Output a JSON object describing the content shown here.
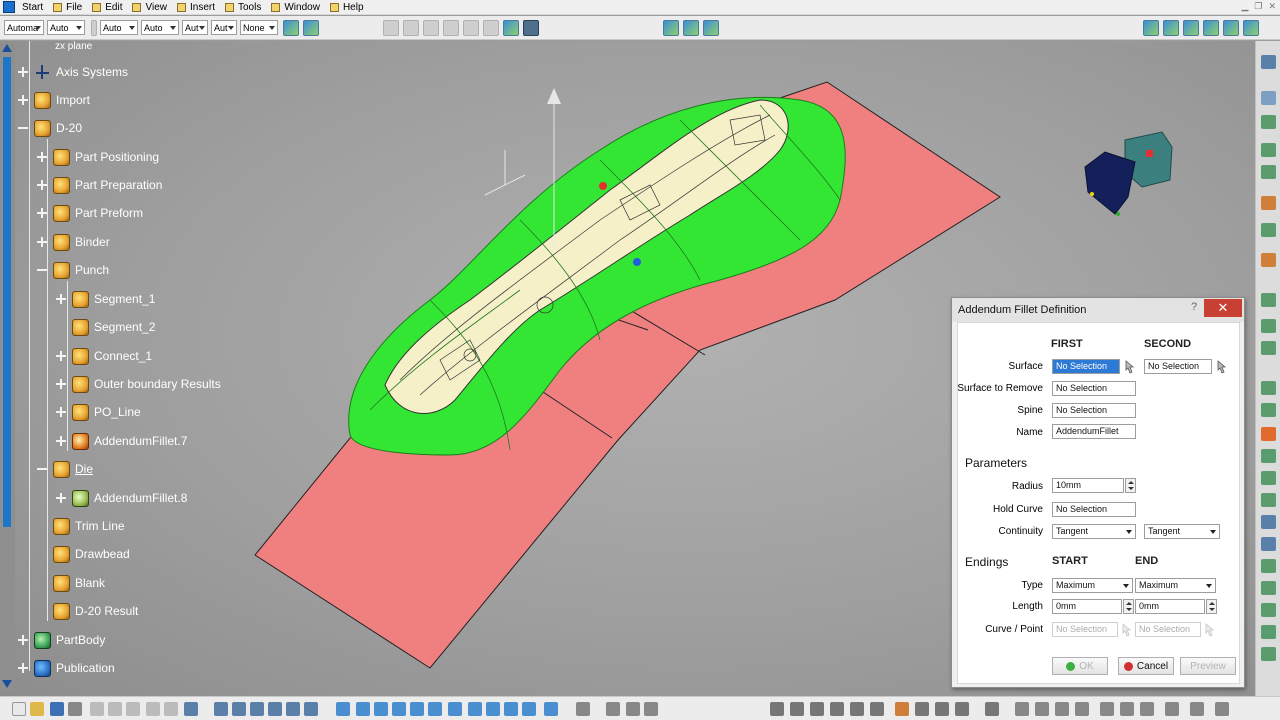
{
  "menu": {
    "items": [
      {
        "label": "Start"
      },
      {
        "label": "File"
      },
      {
        "label": "Edit"
      },
      {
        "label": "View"
      },
      {
        "label": "Insert"
      },
      {
        "label": "Tools"
      },
      {
        "label": "Window"
      },
      {
        "label": "Help"
      }
    ]
  },
  "toolbar": {
    "combos": [
      {
        "value": "Automa"
      },
      {
        "value": "Auto"
      },
      {
        "value": "Auto"
      },
      {
        "value": "Auto"
      },
      {
        "value": "Aut"
      },
      {
        "value": "Aut"
      },
      {
        "value": "None"
      }
    ]
  },
  "tree": {
    "items": [
      {
        "label": "zx plane"
      },
      {
        "label": "Axis Systems"
      },
      {
        "label": "Import"
      },
      {
        "label": "D-20"
      },
      {
        "label": "Part Positioning"
      },
      {
        "label": "Part Preparation"
      },
      {
        "label": "Part Preform"
      },
      {
        "label": "Binder"
      },
      {
        "label": "Punch"
      },
      {
        "label": "Segment_1"
      },
      {
        "label": "Segment_2"
      },
      {
        "label": "Connect_1"
      },
      {
        "label": "Outer boundary Results"
      },
      {
        "label": "PO_Line"
      },
      {
        "label": "AddendumFillet.7"
      },
      {
        "label": "Die"
      },
      {
        "label": "AddendumFillet.8"
      },
      {
        "label": "Trim Line"
      },
      {
        "label": "Drawbead"
      },
      {
        "label": "Blank"
      },
      {
        "label": "D-20 Result"
      },
      {
        "label": "PartBody"
      },
      {
        "label": "Publication"
      }
    ]
  },
  "dialog": {
    "title": "Addendum Fillet Definition",
    "help": "?",
    "close": "✕",
    "col_first": "FIRST",
    "col_second": "SECOND",
    "surface_label": "Surface",
    "surface_first": "No Selection",
    "surface_second": "No Selection",
    "surface_to_remove_label": "Surface to Remove",
    "surface_to_remove": "No Selection",
    "spine_label": "Spine",
    "spine": "No Selection",
    "name_label": "Name",
    "name": "AddendumFillet",
    "parameters_title": "Parameters",
    "radius_label": "Radius",
    "radius": "10mm",
    "hold_curve_label": "Hold Curve",
    "hold_curve": "No Selection",
    "continuity_label": "Continuity",
    "continuity_first": "Tangent",
    "continuity_second": "Tangent",
    "endings_title": "Endings",
    "col_start": "START",
    "col_end": "END",
    "type_label": "Type",
    "type_start": "Maximum",
    "type_end": "Maximum",
    "length_label": "Length",
    "length_start": "0mm",
    "length_end": "0mm",
    "curve_point_label": "Curve / Point",
    "curve_point_start": "No Selection",
    "curve_point_end": "No Selection",
    "ok_label": "OK",
    "cancel_label": "Cancel",
    "preview_label": "Preview"
  },
  "colors": {
    "part_green": "#33e633",
    "flange_pink": "#f08080",
    "tree_text": "#ffffff",
    "selection_blue": "#2d79d6"
  }
}
